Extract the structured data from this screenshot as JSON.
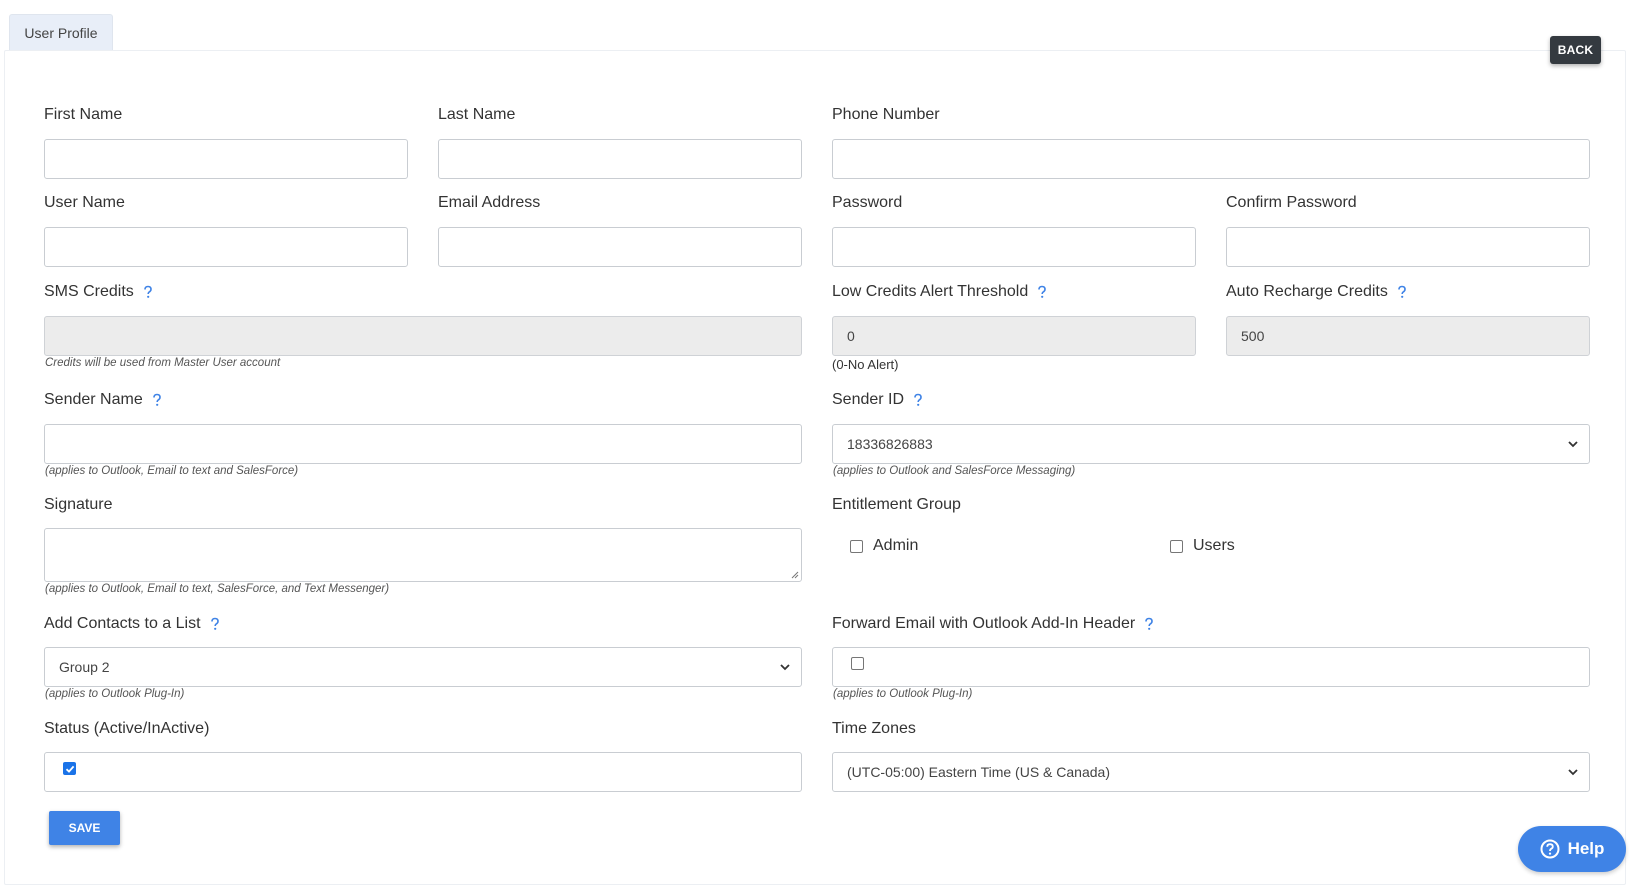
{
  "tab": {
    "label": "User Profile"
  },
  "back_label": "BACK",
  "fields": {
    "first_name": {
      "label": "First Name",
      "value": ""
    },
    "last_name": {
      "label": "Last Name",
      "value": ""
    },
    "phone_number": {
      "label": "Phone Number",
      "value": ""
    },
    "user_name": {
      "label": "User Name",
      "value": ""
    },
    "email_address": {
      "label": "Email Address",
      "value": ""
    },
    "password": {
      "label": "Password",
      "value": ""
    },
    "confirm_password": {
      "label": "Confirm Password",
      "value": ""
    },
    "sms_credits": {
      "label": "SMS Credits",
      "value": "",
      "note": "Credits will be used from Master User account"
    },
    "low_credits": {
      "label": "Low Credits Alert Threshold",
      "value": "0",
      "note": "(0-No Alert)"
    },
    "auto_recharge": {
      "label": "Auto Recharge Credits",
      "value": "500"
    },
    "sender_name": {
      "label": "Sender Name",
      "value": "",
      "note": "(applies to Outlook, Email to text and SalesForce)"
    },
    "sender_id": {
      "label": "Sender ID",
      "value": "18336826883",
      "note": "(applies to Outlook and SalesForce Messaging)"
    },
    "signature": {
      "label": "Signature",
      "value": "",
      "note": "(applies to Outlook, Email to text, SalesForce, and Text Messenger)"
    },
    "entitlement_group": {
      "label": "Entitlement Group",
      "options": [
        "Admin",
        "Users"
      ]
    },
    "add_contacts": {
      "label": "Add Contacts to a List",
      "value": "Group 2",
      "note": "(applies to Outlook Plug-In)"
    },
    "forward_email": {
      "label": "Forward Email with Outlook Add-In Header",
      "note": "(applies to Outlook Plug-In)"
    },
    "status": {
      "label": "Status (Active/InActive)"
    },
    "time_zones": {
      "label": "Time Zones",
      "value": "(UTC-05:00) Eastern Time (US & Canada)"
    }
  },
  "save_label": "SAVE",
  "help_label": "Help",
  "colors": {
    "primary": "#3f83e6",
    "dark": "#343a40",
    "disabled_bg": "#ececec",
    "help_icon": "#3f83e6"
  }
}
